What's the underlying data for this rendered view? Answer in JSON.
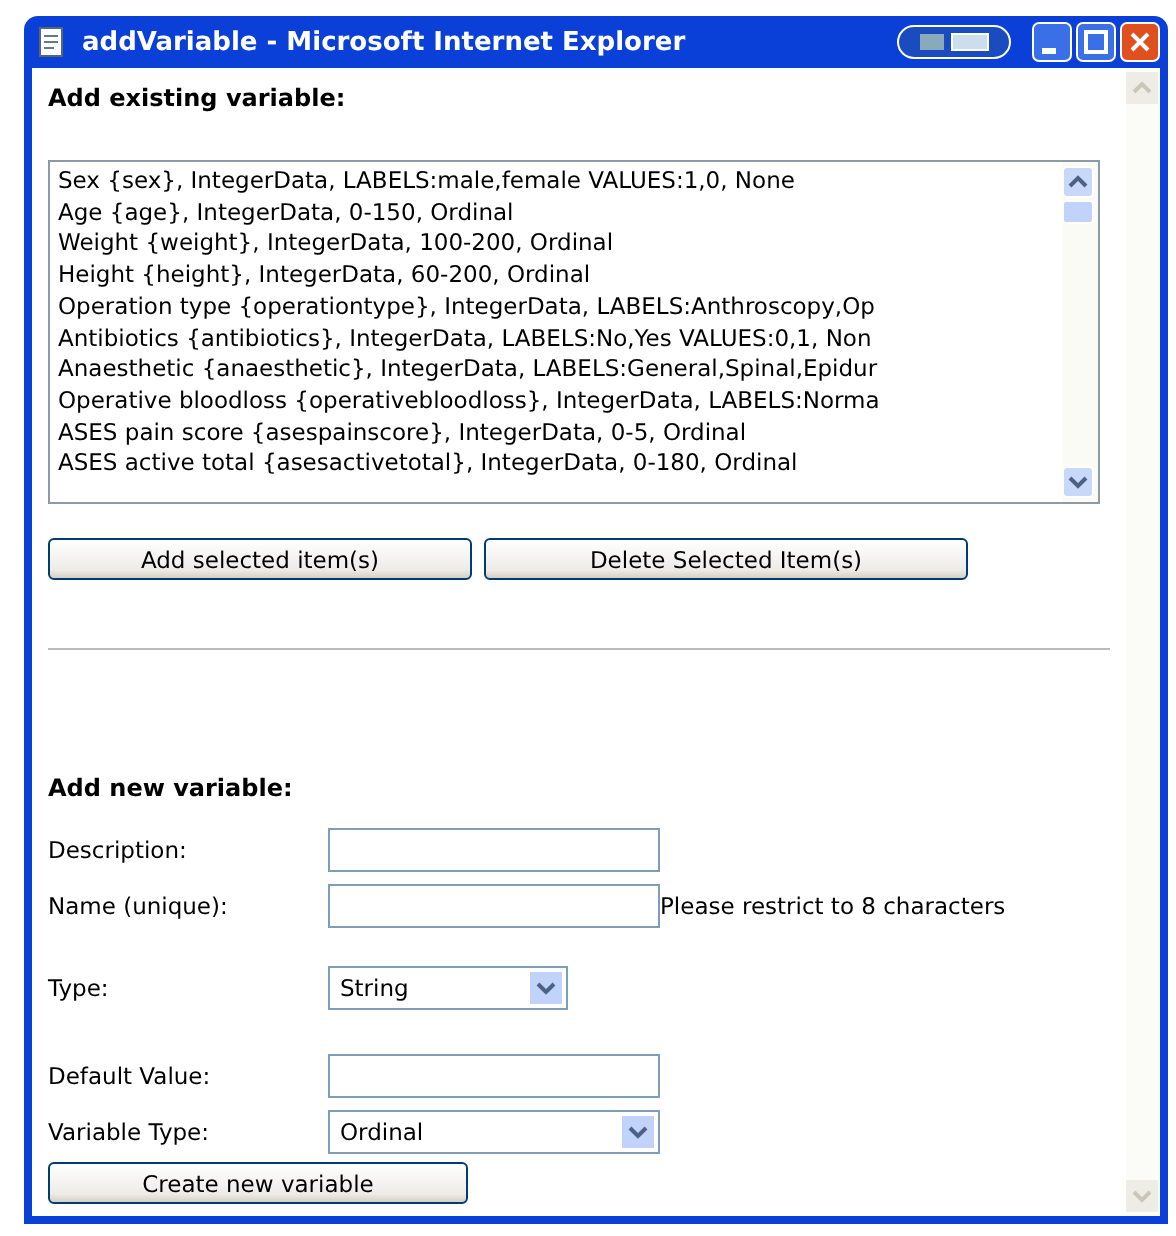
{
  "window": {
    "title": "addVariable - Microsoft Internet Explorer"
  },
  "existing": {
    "heading": "Add existing variable:",
    "items": [
      "Sex {sex}, IntegerData, LABELS:male,female VALUES:1,0, None",
      "Age {age}, IntegerData, 0-150, Ordinal",
      "Weight {weight}, IntegerData, 100-200, Ordinal",
      "Height {height}, IntegerData, 60-200, Ordinal",
      "Operation type {operationtype}, IntegerData, LABELS:Anthroscopy,Op",
      "Antibiotics {antibiotics}, IntegerData, LABELS:No,Yes VALUES:0,1, Non",
      "Anaesthetic {anaesthetic}, IntegerData, LABELS:General,Spinal,Epidur",
      "Operative bloodloss {operativebloodloss}, IntegerData, LABELS:Norma",
      "ASES pain score {asespainscore}, IntegerData, 0-5, Ordinal",
      "ASES active total {asesactivetotal}, IntegerData, 0-180, Ordinal"
    ],
    "buttons": [
      "Add selected item(s)",
      "Delete Selected Item(s)"
    ]
  },
  "new": {
    "heading": "Add new variable:",
    "fields": [
      {
        "kind": "text",
        "label": "Description:"
      },
      {
        "kind": "text",
        "label": "Name (unique):",
        "hint": "Please restrict to 8 characters"
      },
      {
        "kind": "select",
        "label": "Type:",
        "value": "String"
      },
      {
        "kind": "text",
        "label": "Default Value:"
      },
      {
        "kind": "select",
        "label": "Variable Type:",
        "value": "Ordinal"
      }
    ],
    "button": "Create new variable"
  }
}
